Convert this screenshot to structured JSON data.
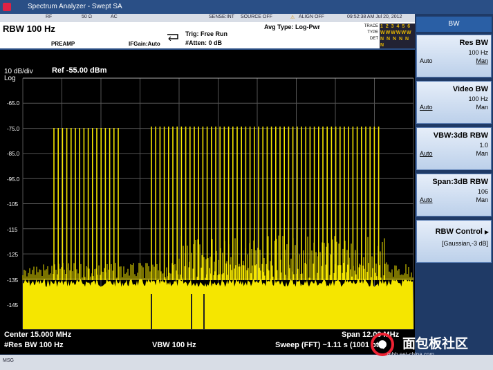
{
  "window": {
    "title": "Spectrum Analyzer - Swept SA"
  },
  "status": {
    "mode": "RF",
    "impedance": "50 Ω",
    "coupling": "AC",
    "sense": "SENSE:INT",
    "source": "SOURCE OFF",
    "align": "ALIGN OFF",
    "datetime": "09:52:38 AM Jul 20, 2012"
  },
  "header": {
    "rbw": "RBW 100 Hz",
    "preamp": "PREAMP",
    "ifgain": "IFGain:Auto",
    "trig": "Trig: Free Run",
    "atten": "#Atten: 0 dB",
    "avg_type": "Avg Type: Log-Pwr",
    "trace_label": "TRACE",
    "type_label": "TYPE",
    "det_label": "DET",
    "trace_nums": "1 2 3 4 5 6",
    "trace_types": "WWWWWW",
    "trace_dets": "N N N N N N"
  },
  "display": {
    "scale": "10 dB/div",
    "log": "Log",
    "ref": "Ref -55.00 dBm",
    "yticks": [
      "-65.0",
      "-75.0",
      "-85.0",
      "-95.0",
      "-105",
      "-115",
      "-125",
      "-135",
      "-145"
    ]
  },
  "footer": {
    "center": "Center 15.000 MHz",
    "resbw": "#Res BW 100 Hz",
    "vbw": "VBW 100 Hz",
    "span": "Span 12.00 MHz",
    "sweep": "Sweep (FFT)  ~1.11 s (1001 pts)"
  },
  "msg": "MSG",
  "softkeys": {
    "title": "BW",
    "keys": [
      {
        "name": "Res BW",
        "value": "100 Hz",
        "left": "Auto",
        "right": "Man"
      },
      {
        "name": "Video BW",
        "value": "100 Hz",
        "left": "Auto",
        "right": "Man"
      },
      {
        "name": "VBW:3dB RBW",
        "value": "1.0",
        "left": "Auto",
        "right": "Man"
      },
      {
        "name": "Span:3dB RBW",
        "value": "106",
        "left": "Auto",
        "right": "Man"
      },
      {
        "name": "RBW Control",
        "value": "[Gaussian,-3 dB]",
        "left": "",
        "right": ""
      }
    ]
  },
  "watermark": {
    "text": "面包板社区",
    "url": "mbb.eet-china.com"
  },
  "colors": {
    "trace": "#f5e600",
    "grid": "#4a4a4a",
    "background": "#000000"
  }
}
